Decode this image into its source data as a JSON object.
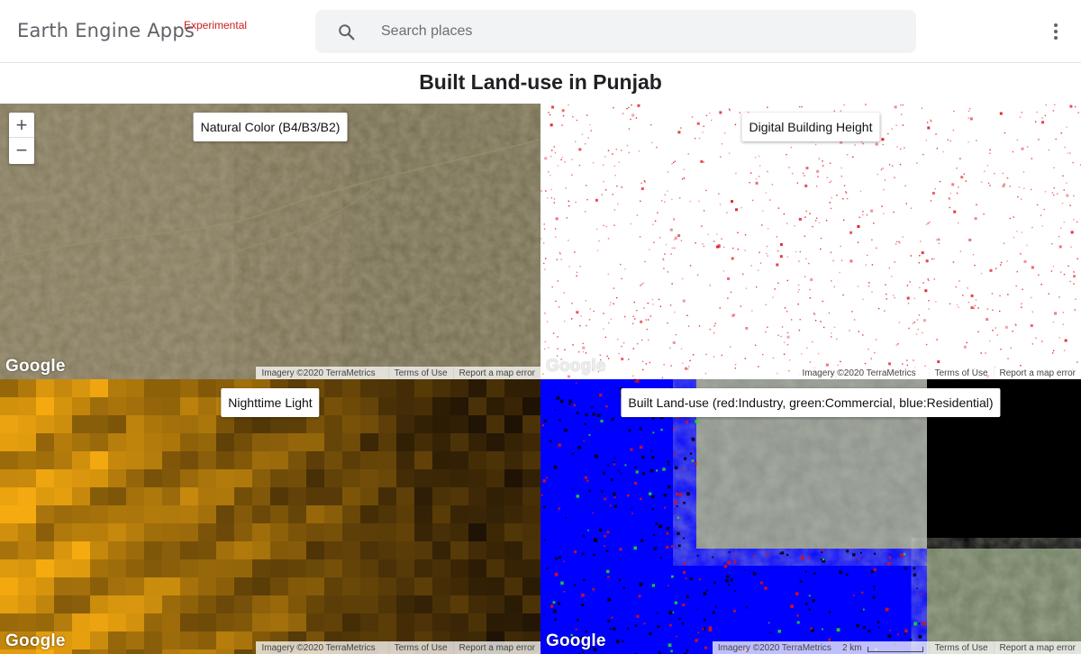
{
  "header": {
    "brand": "Earth Engine Apps",
    "brand_tag": "Experimental",
    "search_placeholder": "Search places"
  },
  "page_title": "Built Land-use in Punjab",
  "maps": [
    {
      "layer_label": "Natural Color (B4/B3/B2)",
      "zoom_in": "+",
      "zoom_out": "−",
      "logo": "Google",
      "attribution": {
        "imagery": "Imagery ©2020 TerraMetrics",
        "terms": "Terms of Use",
        "report": "Report a map error"
      }
    },
    {
      "layer_label": "Digital Building Height",
      "logo": "Google",
      "attribution": {
        "imagery": "Imagery ©2020 TerraMetrics",
        "terms": "Terms of Use",
        "report": "Report a map error"
      }
    },
    {
      "layer_label": "Nighttime Light",
      "logo": "Google",
      "attribution": {
        "imagery": "Imagery ©2020 TerraMetrics",
        "terms": "Terms of Use",
        "report": "Report a map error"
      }
    },
    {
      "layer_label": "Built Land-use (red:Industry, green:Commercial, blue:Residential)",
      "logo": "Google",
      "attribution": {
        "imagery": "Imagery ©2020 TerraMetrics",
        "scale": "2 km",
        "terms": "Terms of Use",
        "report": "Report a map error"
      }
    }
  ],
  "colors": {
    "satellite": "#7a7054",
    "building_height": "#e0202a",
    "nightlight": "#f0a010",
    "industry": "#e01010",
    "commercial": "#20e020",
    "residential": "#0000ff"
  },
  "icons": {
    "search": "search-icon",
    "more": "more-vert-icon"
  }
}
